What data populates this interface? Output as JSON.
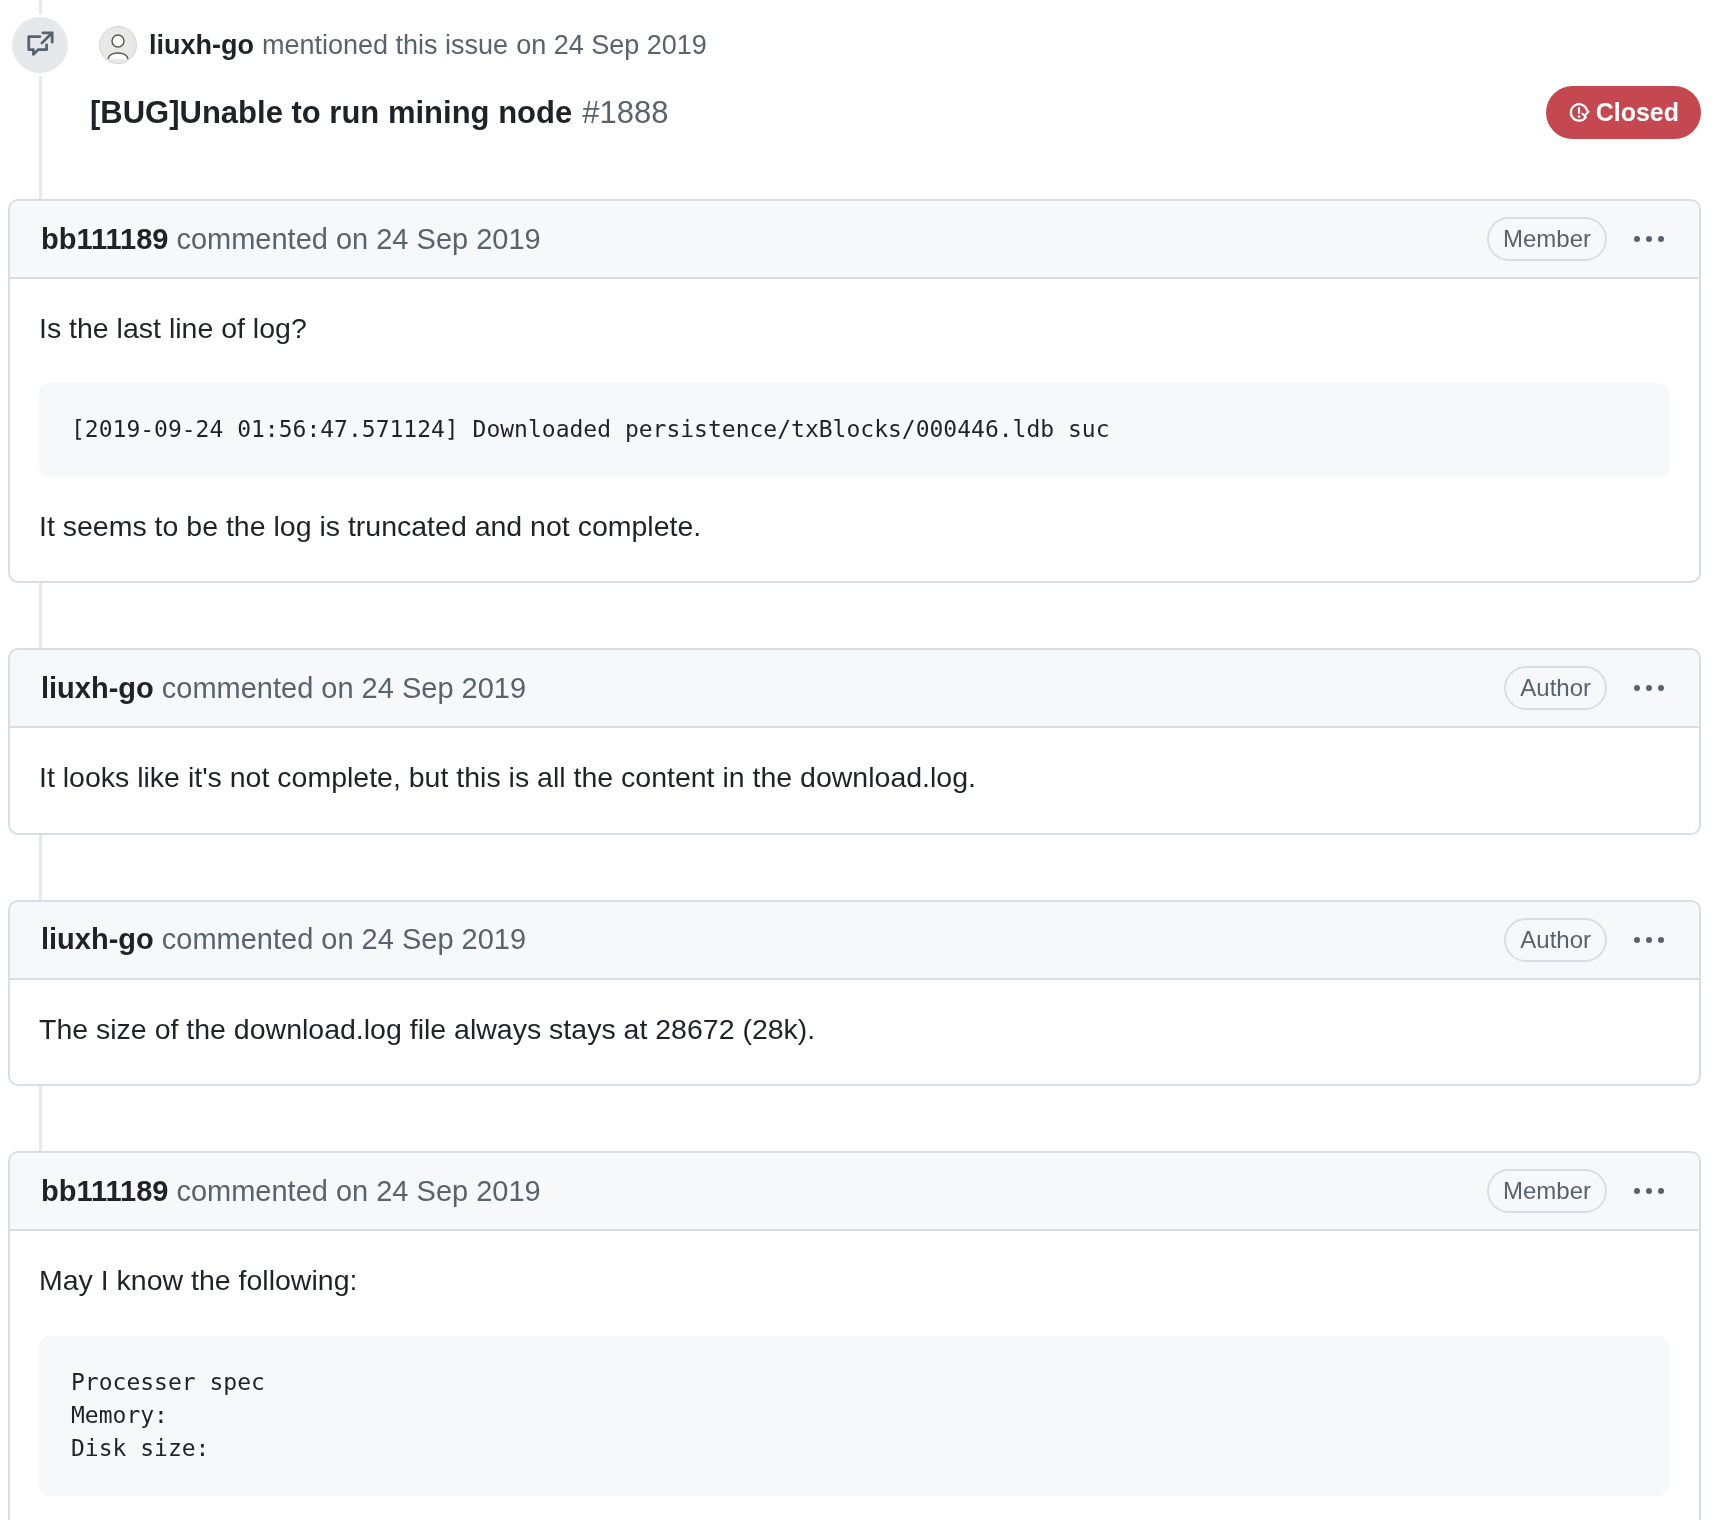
{
  "event": {
    "author": "liuxh-go",
    "action": "mentioned this issue",
    "date": "on 24 Sep 2019",
    "issue_title": "[BUG]Unable to run mining node",
    "issue_number": "#1888",
    "state_label": "Closed"
  },
  "comments": [
    {
      "author": "bb111189",
      "action": "commented",
      "date": "on 24 Sep 2019",
      "role": "Member",
      "body": [
        {
          "kind": "text",
          "text": "Is the last line of log?"
        },
        {
          "kind": "code",
          "text": "[2019-09-24 01:56:47.571124] Downloaded persistence/txBlocks/000446.ldb suc"
        },
        {
          "kind": "text",
          "text": "It seems to be the log is truncated and not complete."
        }
      ]
    },
    {
      "author": "liuxh-go",
      "action": "commented",
      "date": "on 24 Sep 2019",
      "role": "Author",
      "body": [
        {
          "kind": "text",
          "text": "It looks like it's not complete, but this is all the content in the download.log."
        }
      ]
    },
    {
      "author": "liuxh-go",
      "action": "commented",
      "date": "on 24 Sep 2019",
      "role": "Author",
      "body": [
        {
          "kind": "text",
          "text": "The size of the download.log file always stays at 28672 (28k)."
        }
      ]
    },
    {
      "author": "bb111189",
      "action": "commented",
      "date": "on 24 Sep 2019",
      "role": "Member",
      "body": [
        {
          "kind": "text",
          "text": "May I know the following:"
        },
        {
          "kind": "code",
          "text": "Processer spec\nMemory:\nDisk size:"
        }
      ]
    }
  ]
}
